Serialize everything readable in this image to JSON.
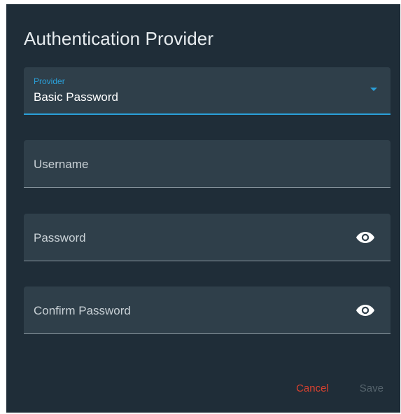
{
  "dialog": {
    "title": "Authentication Provider",
    "provider": {
      "label": "Provider",
      "value": "Basic Password",
      "icon": "dropdown-arrow-icon"
    },
    "username": {
      "placeholder": "Username"
    },
    "password": {
      "placeholder": "Password",
      "icon": "eye-icon"
    },
    "confirm_password": {
      "placeholder": "Confirm Password",
      "icon": "eye-icon"
    },
    "actions": {
      "cancel_label": "Cancel",
      "save_label": "Save"
    }
  },
  "colors": {
    "dialog_bg": "#1f2d38",
    "field_bg": "#2f3f4a",
    "accent": "#2a9fd8",
    "cancel": "#d9412f",
    "save_disabled": "#56646d"
  }
}
